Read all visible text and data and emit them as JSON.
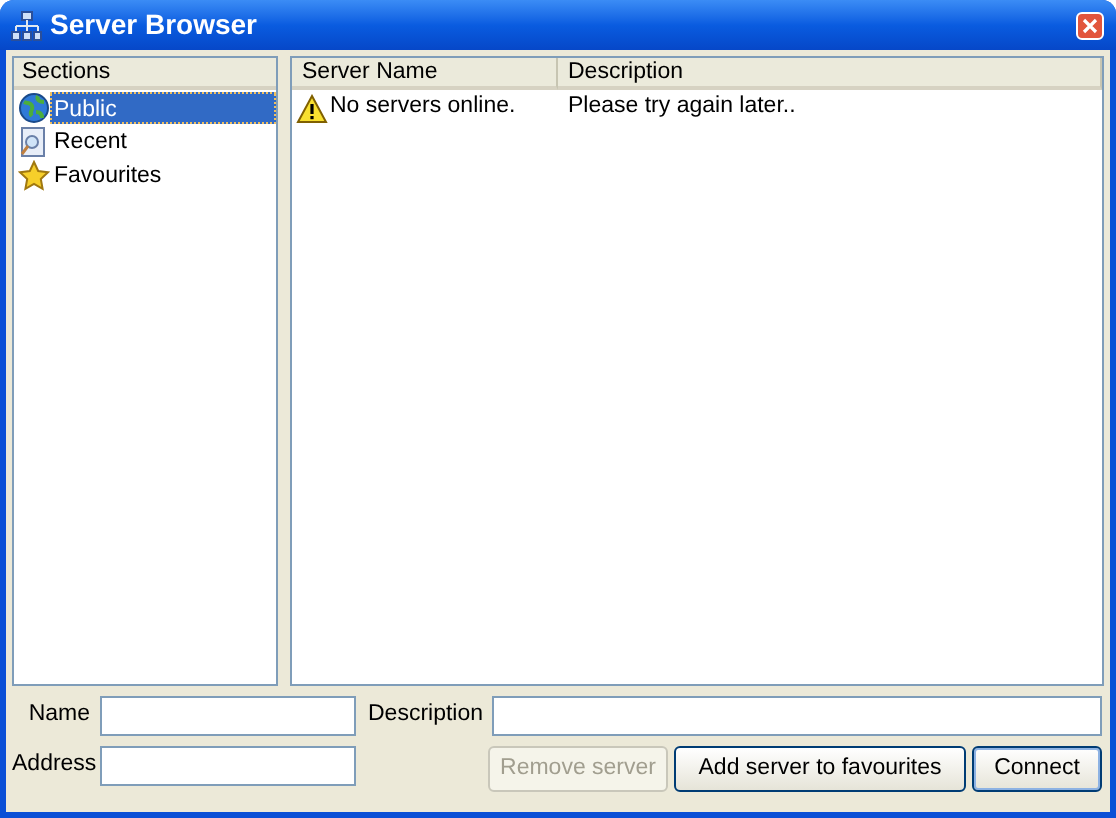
{
  "window": {
    "title": "Server Browser"
  },
  "sections": {
    "header": "Sections",
    "items": [
      {
        "label": "Public",
        "kind": "globe",
        "selected": true
      },
      {
        "label": "Recent",
        "kind": "document",
        "selected": false
      },
      {
        "label": "Favourites",
        "kind": "star",
        "selected": false
      }
    ]
  },
  "table": {
    "columns": [
      "Server Name",
      "Description"
    ],
    "rows": [
      {
        "kind": "warning",
        "cells": [
          "No servers online.",
          "Please try again later.."
        ]
      }
    ]
  },
  "form": {
    "name": {
      "label": "Name"
    },
    "address": {
      "label": "Address"
    },
    "description": {
      "label": "Description"
    }
  },
  "buttons": [
    {
      "label": "Remove server",
      "disabled": true,
      "default": false
    },
    {
      "label": "Add server to favourites",
      "disabled": false,
      "default": false
    },
    {
      "label": "Connect",
      "disabled": false,
      "default": true
    }
  ]
}
